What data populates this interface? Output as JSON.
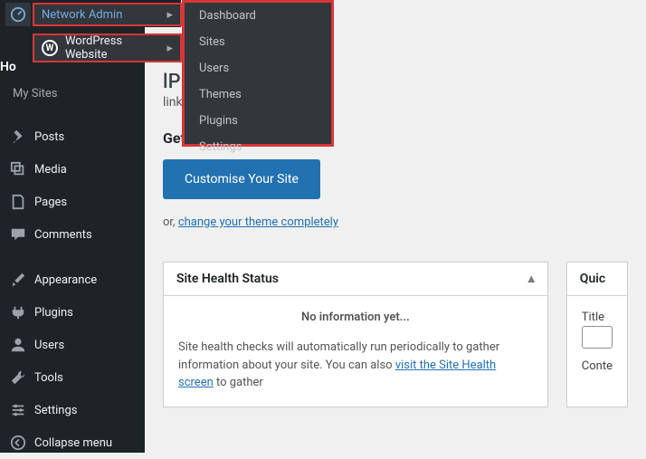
{
  "topbar": {
    "network_admin": "Network Admin",
    "wp_site": "WordPress Website",
    "submenu": [
      "Dashboard",
      "Sites",
      "Users",
      "Themes",
      "Plugins",
      "Settings"
    ]
  },
  "sidebar": {
    "home": "Ho",
    "my_sites": "My Sites",
    "items": [
      "Posts",
      "Media",
      "Pages",
      "Comments",
      "Appearance",
      "Plugins",
      "Users",
      "Tools",
      "Settings"
    ],
    "collapse": "Collapse menu"
  },
  "welcome": {
    "title_suffix": "lPress!",
    "subtitle_suffix": "links to get you started:",
    "get_started": "Get Started",
    "customise_btn": "Customise Your Site",
    "or_prefix": "or, ",
    "or_link": "change your theme completely"
  },
  "health": {
    "title": "Site Health Status",
    "no_info": "No information yet...",
    "text_before": "Site health checks will automatically run periodically to gather information about your site. You can also ",
    "link": "visit the Site Health screen",
    "text_after": " to gather "
  },
  "quick": {
    "title": "Quic",
    "title_field": "Title",
    "content_field": "Conte"
  }
}
